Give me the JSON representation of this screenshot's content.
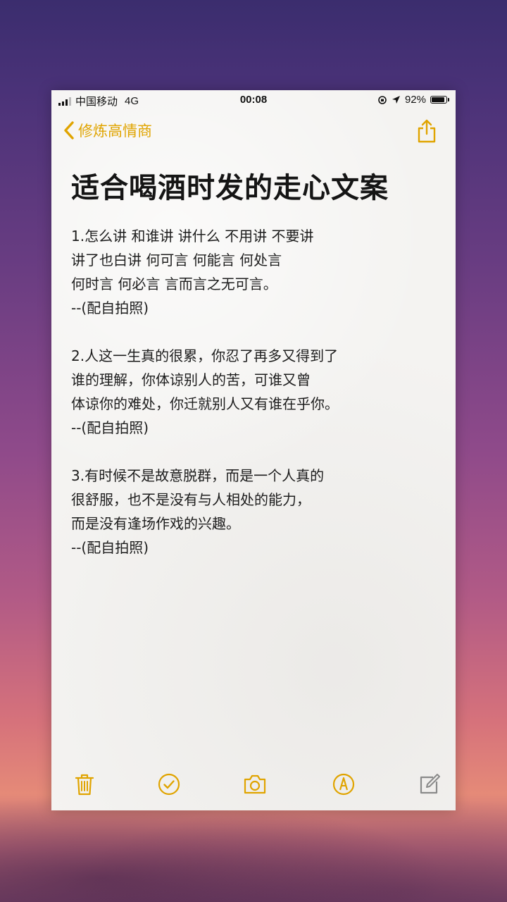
{
  "status_bar": {
    "carrier": "中国移动",
    "network": "4G",
    "time": "00:08",
    "battery": "92%",
    "battery_level": 0.92
  },
  "nav": {
    "back_label": "修炼高情商"
  },
  "note": {
    "title": "适合喝酒时发的走心文案",
    "sections": [
      {
        "lines": [
          "1.怎么讲 和谁讲 讲什么 不用讲 不要讲",
          "讲了也白讲 何可言 何能言 何处言",
          "何时言 何必言 言而言之无可言。",
          "--(配自拍照)"
        ]
      },
      {
        "lines": [
          "2.人这一生真的很累，你忍了再多又得到了",
          "谁的理解，你体谅别人的苦，可谁又曾",
          "体谅你的难处，你迁就别人又有谁在乎你。",
          "--(配自拍照)"
        ]
      },
      {
        "lines": [
          "3.有时候不是故意脱群，而是一个人真的",
          "很舒服，也不是没有与人相处的能力，",
          "而是没有逢场作戏的兴趣。",
          "--(配自拍照)"
        ]
      }
    ]
  },
  "toolbar": {
    "icons": [
      "trash-icon",
      "checklist-icon",
      "camera-icon",
      "markup-icon",
      "compose-icon"
    ]
  },
  "colors": {
    "accent": "#e0a400",
    "text": "#1d1d1d",
    "paper": "#f4f3f1"
  }
}
